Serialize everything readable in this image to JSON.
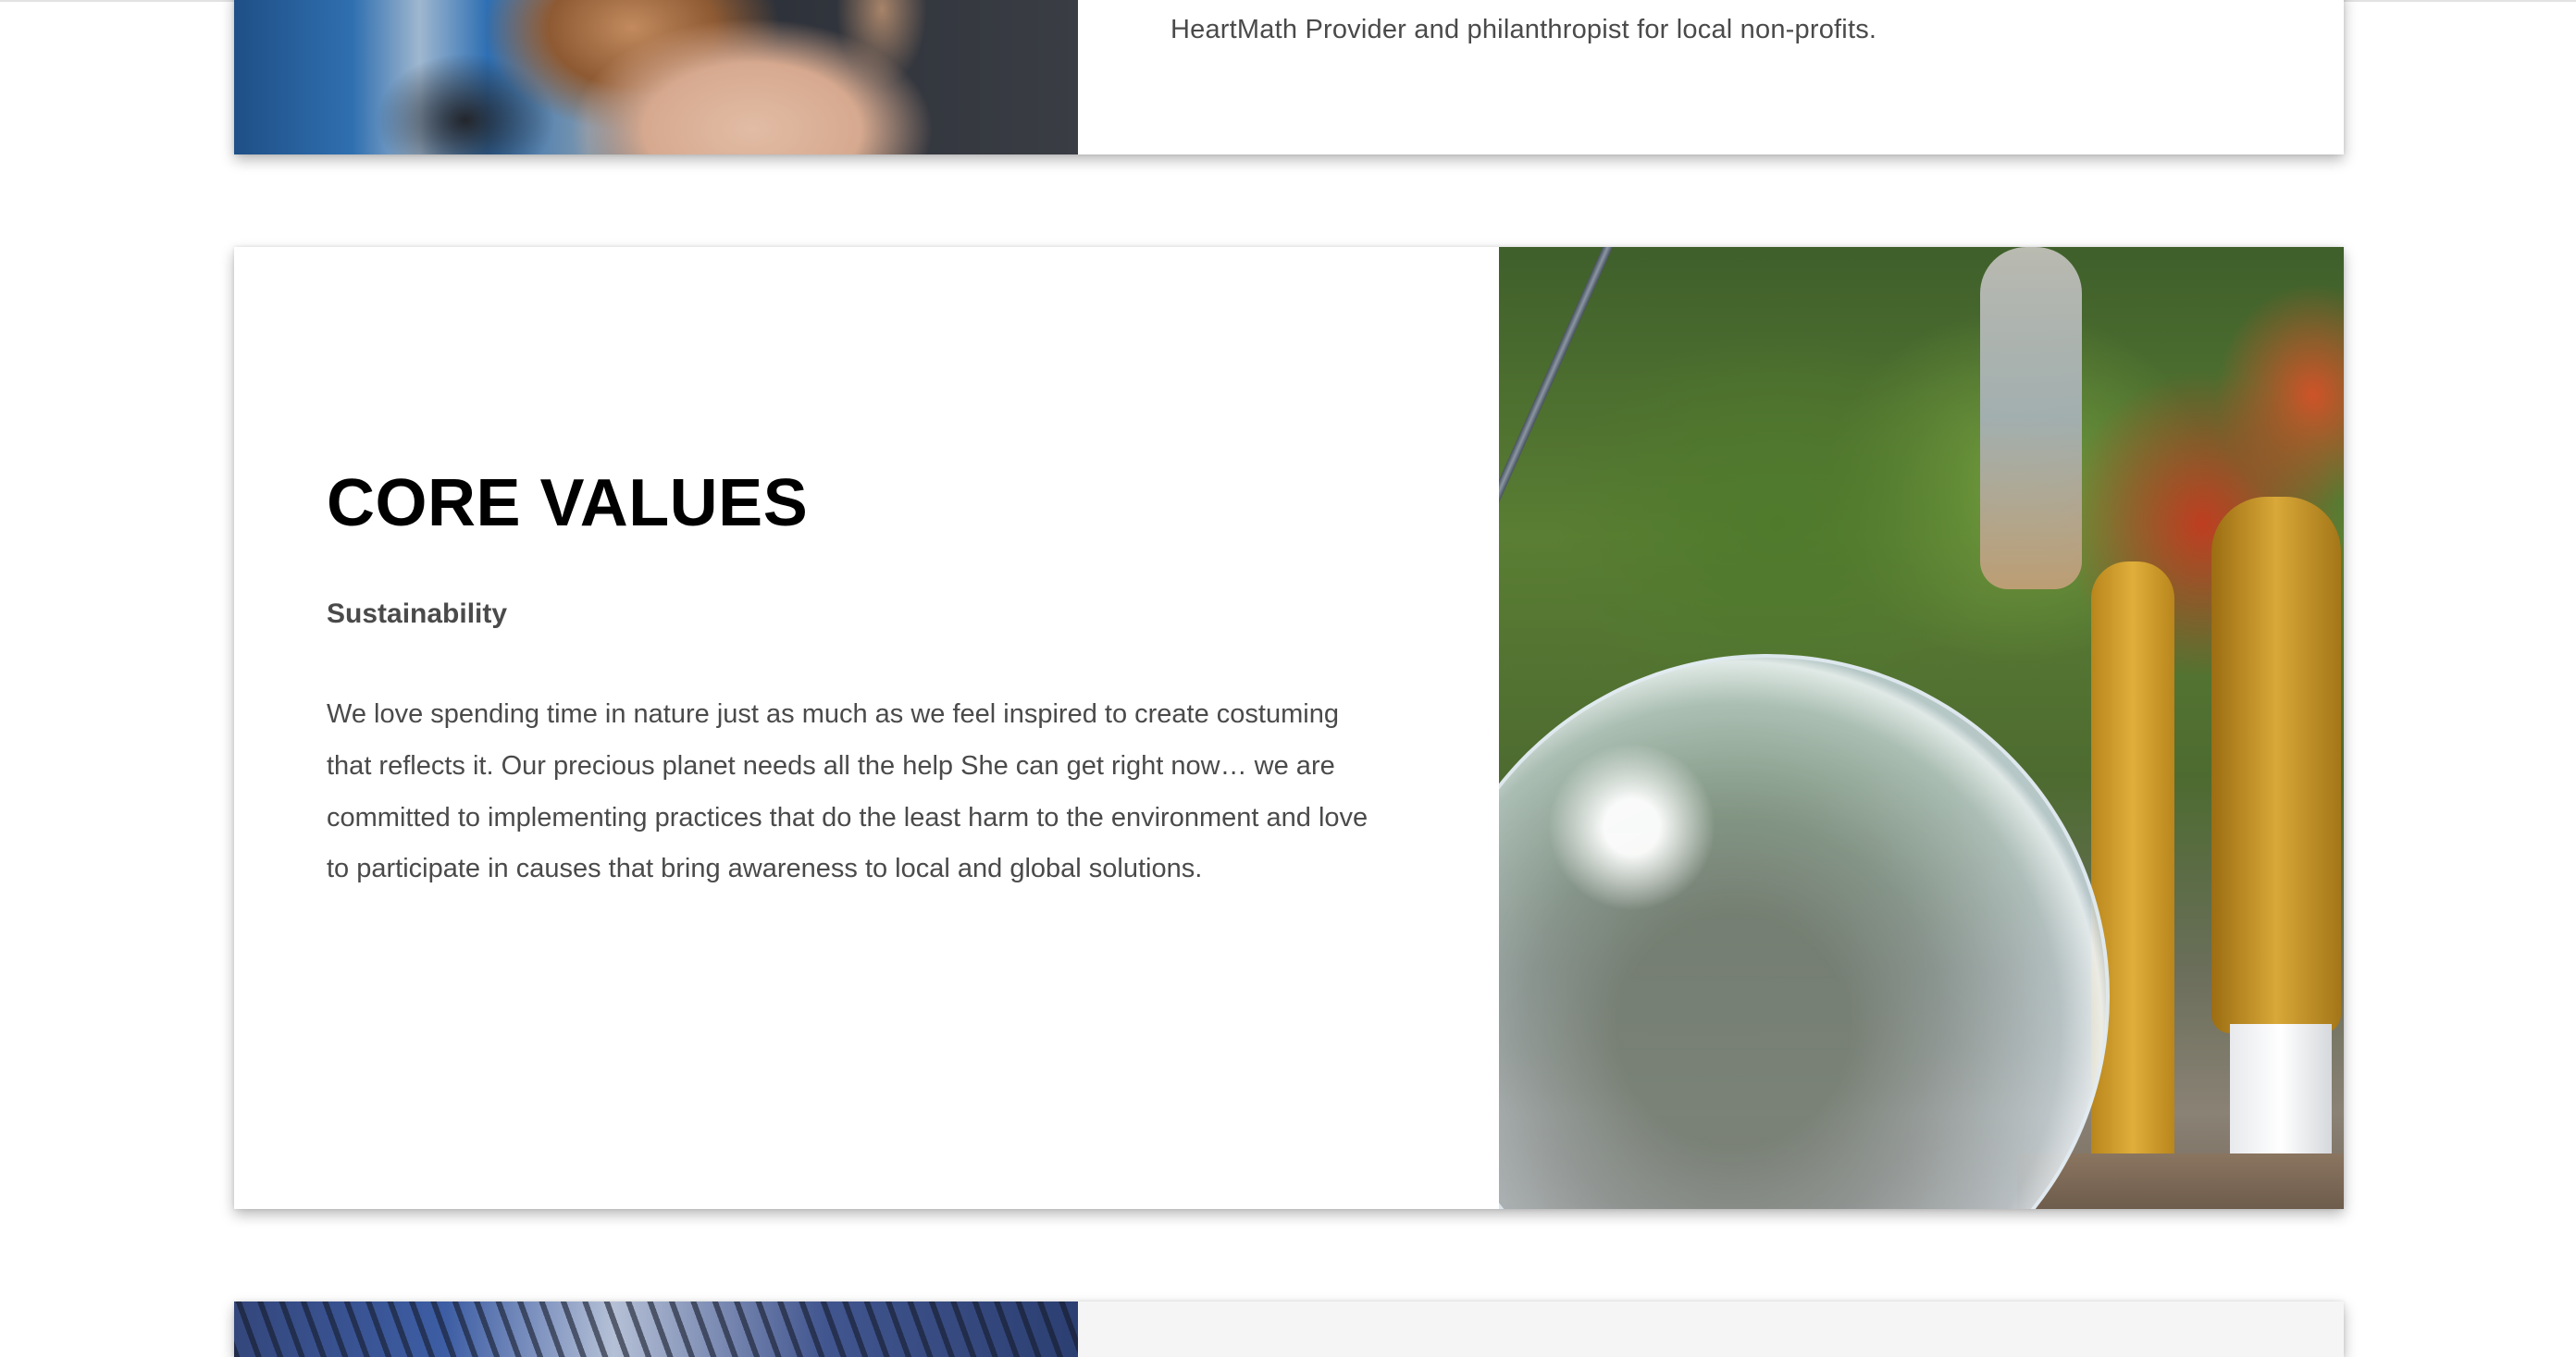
{
  "intro_card": {
    "body_fragment": "HeartMath Provider and philanthropist for local non-profits."
  },
  "core_values": {
    "title": "CORE VALUES",
    "subtitle": "Sustainability",
    "body": "We love spending time in nature just as much as we feel inspired to create costuming that reflects it. Our precious planet needs all the help She can get right now… we are committed to implementing practices that do the least harm to the environment and love to participate in causes that bring awareness to local and global solutions."
  },
  "colors": {
    "heading": "#000000",
    "body_text": "#4a4a4a",
    "card_background": "#ffffff",
    "page_background": "#ffffff"
  }
}
